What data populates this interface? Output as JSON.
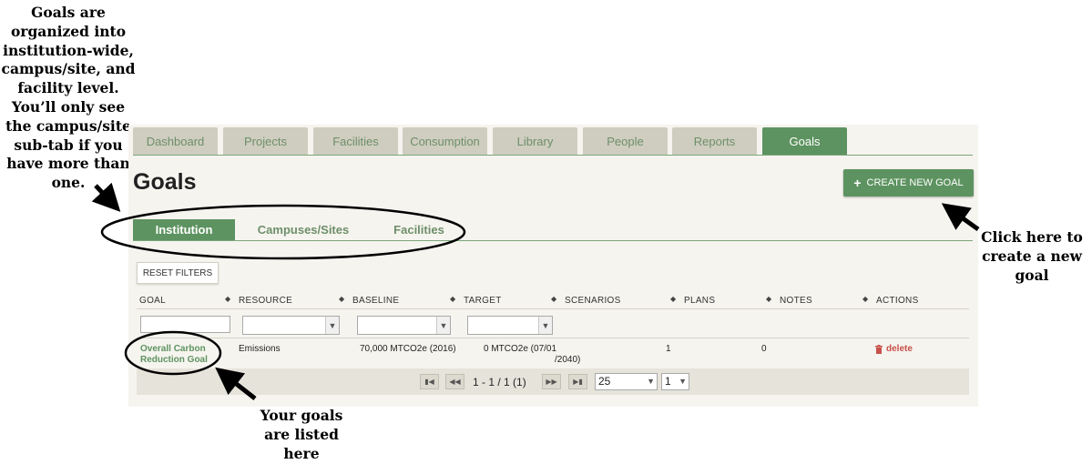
{
  "annotations": {
    "left": "Goals are organized into institution-wide, campus/site, and facility level. You’ll only see the campus/site sub-tab if you have more than one.",
    "right": "Click here to create a new goal",
    "bottom": "Your goals are listed here"
  },
  "tabs": [
    "Dashboard",
    "Projects",
    "Facilities",
    "Consumption",
    "Library",
    "People",
    "Reports",
    "Goals"
  ],
  "active_tab": "Goals",
  "page_title": "Goals",
  "create_button": "CREATE NEW GOAL",
  "subtabs": [
    "Institution",
    "Campuses/Sites",
    "Facilities"
  ],
  "active_subtab": "Institution",
  "reset_filters": "RESET FILTERS",
  "columns": [
    "GOAL",
    "RESOURCE",
    "BASELINE",
    "TARGET",
    "SCENARIOS",
    "PLANS",
    "NOTES",
    "ACTIONS"
  ],
  "rows": [
    {
      "goal_line1": "Overall Carbon",
      "goal_line2": "Reduction Goal",
      "resource": "Emissions",
      "baseline": "70,000 MTCO2e (2016)",
      "target_line1": "0 MTCO2e (07/01",
      "target_line2": "/2040)",
      "scenarios": "1",
      "plans": "0",
      "notes": "",
      "action": "delete"
    }
  ],
  "pagination": {
    "info": "1 - 1 / 1 (1)",
    "page_size": "25",
    "page": "1"
  },
  "colors": {
    "brand_green": "#5d9360",
    "tab_inactive": "#cfcdbf",
    "delete_red": "#c9504a"
  }
}
